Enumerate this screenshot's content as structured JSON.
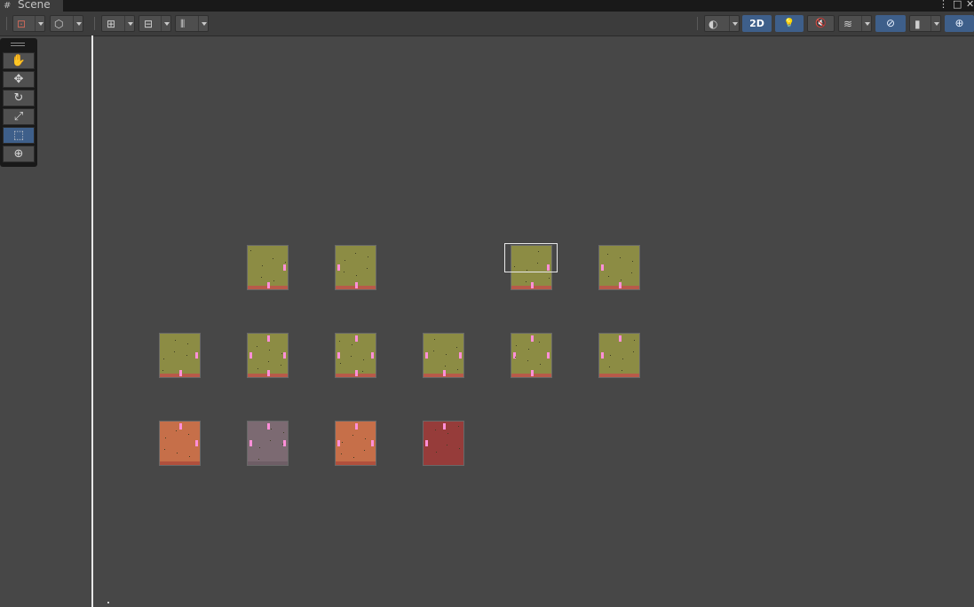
{
  "window": {
    "tab_label": "Scene",
    "tab_icon": "#",
    "more_glyph": "⋮",
    "maximize_glyph": "□",
    "close_glyph": "✕"
  },
  "toolbar": {
    "twod_label": "2D",
    "left": [
      {
        "name": "draw-mode-icon",
        "glyph": "⊡"
      },
      {
        "name": "render-cube-icon",
        "glyph": "⬡"
      },
      {
        "name": "grid-snap-icon",
        "glyph": "⊞"
      },
      {
        "name": "increment-snap-icon",
        "glyph": "⊟"
      },
      {
        "name": "align-ruler-icon",
        "glyph": "⦀"
      }
    ],
    "right": [
      {
        "name": "shading-sphere-icon",
        "glyph": "◐"
      },
      {
        "name": "lighting-bulb-icon",
        "glyph": "💡"
      },
      {
        "name": "audio-mute-icon",
        "glyph": "🔇"
      },
      {
        "name": "effects-layers-icon",
        "glyph": "≋"
      },
      {
        "name": "scene-visibility-icon",
        "glyph": "⊘"
      },
      {
        "name": "camera-icon",
        "glyph": "▮"
      },
      {
        "name": "gizmos-icon",
        "glyph": "⊕"
      }
    ]
  },
  "tools": [
    {
      "name": "view-hand-tool",
      "glyph": "✋",
      "active": false
    },
    {
      "name": "move-tool",
      "glyph": "✥",
      "active": false
    },
    {
      "name": "rotate-tool",
      "glyph": "↻",
      "active": false
    },
    {
      "name": "scale-tool",
      "glyph": "⤢",
      "active": false
    },
    {
      "name": "rect-tool",
      "glyph": "⬚",
      "active": true
    },
    {
      "name": "transform-tool",
      "glyph": "⊕",
      "active": false
    }
  ],
  "rooms": [
    {
      "row": 0,
      "col": 1,
      "color": "#8c8c44",
      "base": "#b85a4a",
      "doors": [
        "b",
        "r"
      ]
    },
    {
      "row": 0,
      "col": 2,
      "color": "#8c8c44",
      "base": "#b85a4a",
      "doors": [
        "b",
        "l"
      ]
    },
    {
      "row": 0,
      "col": 4,
      "color": "#8c8c44",
      "base": "#b85a4a",
      "doors": [
        "b",
        "r"
      ]
    },
    {
      "row": 0,
      "col": 5,
      "color": "#8c8c44",
      "base": "#b85a4a",
      "doors": [
        "b",
        "l"
      ]
    },
    {
      "row": 1,
      "col": 0,
      "color": "#8c8c44",
      "base": "#b85a4a",
      "doors": [
        "b",
        "r"
      ]
    },
    {
      "row": 1,
      "col": 1,
      "color": "#8c8c44",
      "base": "#b85a4a",
      "doors": [
        "t",
        "b",
        "l",
        "r"
      ]
    },
    {
      "row": 1,
      "col": 2,
      "color": "#8c8c44",
      "base": "#b85a4a",
      "doors": [
        "t",
        "b",
        "l",
        "r"
      ]
    },
    {
      "row": 1,
      "col": 3,
      "color": "#8c8c44",
      "base": "#b85a4a",
      "doors": [
        "b",
        "l",
        "r"
      ]
    },
    {
      "row": 1,
      "col": 4,
      "color": "#8c8c44",
      "base": "#b85a4a",
      "doors": [
        "t",
        "b",
        "l",
        "r"
      ]
    },
    {
      "row": 1,
      "col": 5,
      "color": "#8c8c44",
      "base": "#b85a4a",
      "doors": [
        "t",
        "l"
      ]
    },
    {
      "row": 2,
      "col": 0,
      "color": "#c66f49",
      "base": "#b0503d",
      "doors": [
        "t",
        "r"
      ]
    },
    {
      "row": 2,
      "col": 1,
      "color": "#7c6a72",
      "base": "#6e5e66",
      "doors": [
        "t",
        "l",
        "r"
      ]
    },
    {
      "row": 2,
      "col": 2,
      "color": "#c66f49",
      "base": "#b0503d",
      "doors": [
        "t",
        "l",
        "r"
      ]
    },
    {
      "row": 2,
      "col": 3,
      "color": "#963c3a",
      "base": "#963c3a",
      "doors": [
        "t",
        "l"
      ]
    }
  ],
  "selected_room": {
    "row": 0,
    "col": 4
  }
}
